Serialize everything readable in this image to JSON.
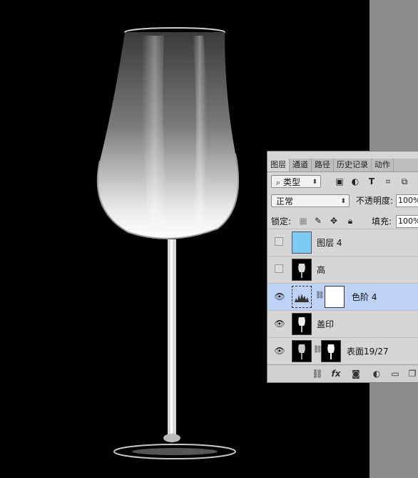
{
  "tabs": [
    "图层",
    "通道",
    "路径",
    "历史记录",
    "动作"
  ],
  "filter": {
    "kind_label": "类型"
  },
  "blend": {
    "mode": "正常",
    "opacity_label": "不透明度:",
    "opacity_value": "100%"
  },
  "lock": {
    "label": "锁定:",
    "fill_label": "填充:",
    "fill_value": "100%"
  },
  "layers": [
    {
      "name": "图层 4",
      "visible": false
    },
    {
      "name": "高",
      "visible": false
    },
    {
      "name": "色阶 4",
      "visible": true,
      "selected": true
    },
    {
      "name": "盖印",
      "visible": true
    },
    {
      "name": "表面19/27",
      "visible": true
    }
  ],
  "icons": {
    "filter": [
      "image-filter-icon",
      "adjustment-filter-icon",
      "type-filter-icon",
      "shape-filter-icon",
      "smart-object-filter-icon"
    ],
    "lock": [
      "lock-transparent-icon",
      "lock-paint-icon",
      "lock-move-icon",
      "lock-all-icon"
    ],
    "footer": [
      "link-icon",
      "fx-icon",
      "mask-icon",
      "adjustment-icon",
      "folder-icon",
      "new-layer-icon"
    ]
  }
}
